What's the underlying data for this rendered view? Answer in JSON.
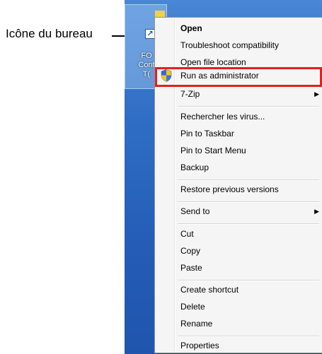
{
  "callout": {
    "label": "Icône du bureau"
  },
  "desktop_icon": {
    "line1": "FO",
    "line2": "Cont",
    "line3": "T("
  },
  "menu": {
    "items": [
      {
        "label": "Open",
        "bold": true
      },
      {
        "label": "Troubleshoot compatibility"
      },
      {
        "label": "Open file location"
      },
      {
        "label": "Run as administrator",
        "icon": "shield-icon",
        "highlighted": true
      },
      {
        "label": "7-Zip",
        "submenu": true
      },
      {
        "label": "Rechercher les virus..."
      },
      {
        "label": "Pin to Taskbar"
      },
      {
        "label": "Pin to Start Menu"
      },
      {
        "label": "Backup"
      },
      {
        "label": "Restore previous versions"
      },
      {
        "label": "Send to",
        "submenu": true
      },
      {
        "label": "Cut"
      },
      {
        "label": "Copy"
      },
      {
        "label": "Paste"
      },
      {
        "label": "Create shortcut"
      },
      {
        "label": "Delete"
      },
      {
        "label": "Rename"
      },
      {
        "label": "Properties"
      }
    ],
    "submenu_arrow": "▶"
  },
  "colors": {
    "highlight_border": "#e0201e",
    "desktop": "#2f6dc4",
    "menu_bg": "#f5f5f5"
  }
}
